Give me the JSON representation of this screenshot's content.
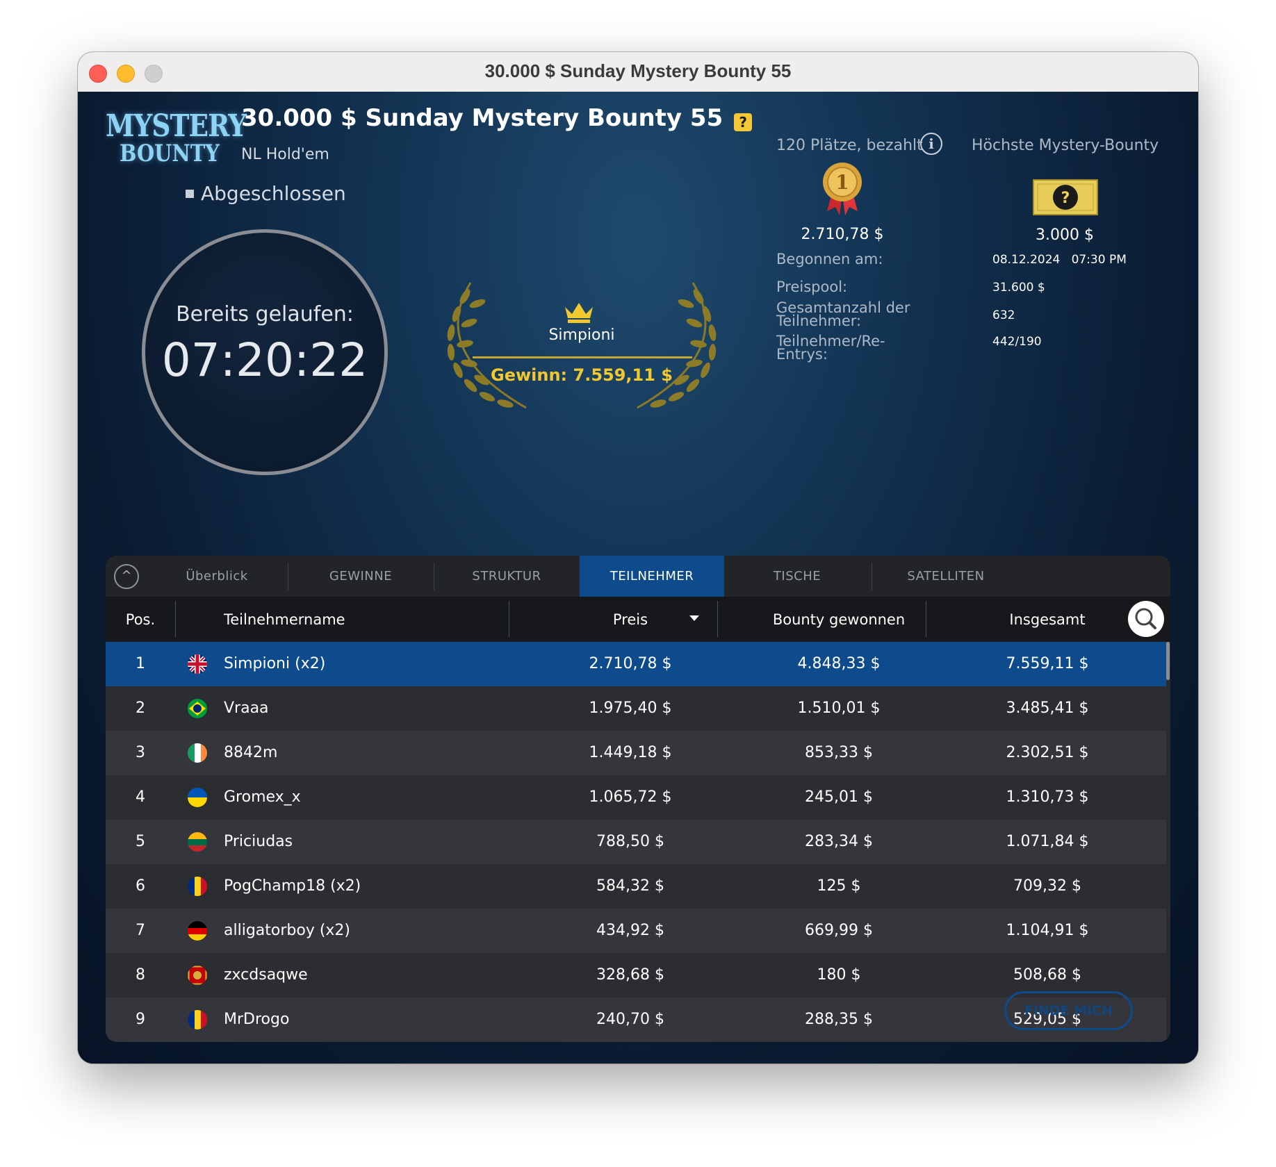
{
  "window": {
    "title": "30.000 $ Sunday Mystery Bounty 55"
  },
  "logo": {
    "line1": "MYSTERY",
    "line2": "BOUNTY"
  },
  "header": {
    "title": "30.000 $ Sunday Mystery Bounty 55",
    "game_type": "NL Hold'em",
    "status": "Abgeschlossen"
  },
  "timer": {
    "label": "Bereits gelaufen:",
    "value": "07:20:22"
  },
  "winner": {
    "name": "Simpioni",
    "prize": "Gewinn: 7.559,11 $"
  },
  "payouts": {
    "paid_places": "120 Plätze, bezahlt",
    "highest_bounty_label": "Höchste Mystery-Bounty",
    "first_place_value": "2.710,78 $",
    "highest_bounty_value": "3.000 $"
  },
  "details": {
    "started_label": "Begonnen am:",
    "started_date": "08.12.2024",
    "started_time": "07:30 PM",
    "prizepool_label": "Preispool:",
    "prizepool_value": "31.600 $",
    "total_label": "Gesamtanzahl der Teilnehmer:",
    "total_value": "632",
    "entries_label": "Teilnehmer/Re-Entrys:",
    "entries_value": "442/190"
  },
  "tabs": [
    {
      "label": "Überblick"
    },
    {
      "label": "GEWINNE"
    },
    {
      "label": "STRUKTUR"
    },
    {
      "label": "TEILNEHMER",
      "active": true
    },
    {
      "label": "TISCHE"
    },
    {
      "label": "SATELLITEN"
    }
  ],
  "table": {
    "columns": {
      "pos": "Pos.",
      "name": "Teilnehmername",
      "preis": "Preis",
      "bounty": "Bounty gewonnen",
      "total": "Insgesamt"
    },
    "rows": [
      {
        "pos": "1",
        "flag": "gb-flag-icon",
        "name": "Simpioni (x2)",
        "preis": "2.710,78 $",
        "bounty": "4.848,33 $",
        "total": "7.559,11 $",
        "selected": true
      },
      {
        "pos": "2",
        "flag": "br-flag-icon",
        "name": "Vraaa",
        "preis": "1.975,40 $",
        "bounty": "1.510,01 $",
        "total": "3.485,41 $"
      },
      {
        "pos": "3",
        "flag": "ie-flag-icon",
        "name": "8842m",
        "preis": "1.449,18 $",
        "bounty": "853,33 $",
        "total": "2.302,51 $"
      },
      {
        "pos": "4",
        "flag": "ua-flag-icon",
        "name": "Gromex_x",
        "preis": "1.065,72 $",
        "bounty": "245,01 $",
        "total": "1.310,73 $"
      },
      {
        "pos": "5",
        "flag": "lt-flag-icon",
        "name": "Priciudas",
        "preis": "788,50 $",
        "bounty": "283,34 $",
        "total": "1.071,84 $"
      },
      {
        "pos": "6",
        "flag": "ro-flag-icon",
        "name": "PogChamp18 (x2)",
        "preis": "584,32 $",
        "bounty": "125 $",
        "total": "709,32 $"
      },
      {
        "pos": "7",
        "flag": "de-flag-icon",
        "name": "alligatorboy (x2)",
        "preis": "434,92 $",
        "bounty": "669,99 $",
        "total": "1.104,91 $"
      },
      {
        "pos": "8",
        "flag": "me-flag-icon",
        "name": "zxcdsaqwe",
        "preis": "328,68 $",
        "bounty": "180 $",
        "total": "508,68 $"
      },
      {
        "pos": "9",
        "flag": "ro-flag-icon",
        "name": "MrDrogo",
        "preis": "240,70 $",
        "bounty": "288,35 $",
        "total": "529,05 $"
      }
    ]
  },
  "find_me": "FINDE MICH",
  "colors": {
    "accent": "#0d4b8c",
    "gold": "#f2c82f"
  }
}
